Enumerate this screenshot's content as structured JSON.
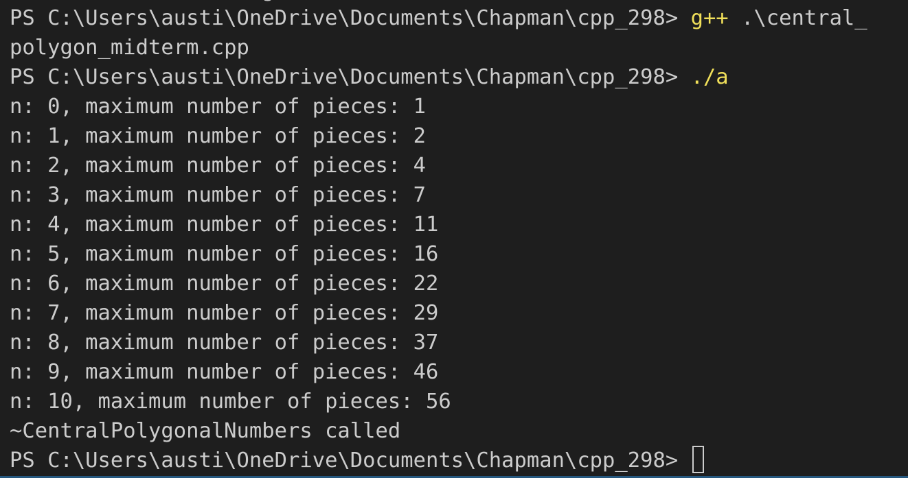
{
  "terminal": {
    "partial_top_line": "                    g",
    "prompt": "PS C:\\Users\\austi\\OneDrive\\Documents\\Chapman\\cpp_298> ",
    "command1_part1": "g++",
    "command1_part2": " .\\central_",
    "command1_wrap": "polygon_midterm.cpp",
    "command2": "./a",
    "output_lines": [
      "n: 0, maximum number of pieces: 1",
      "n: 1, maximum number of pieces: 2",
      "n: 2, maximum number of pieces: 4",
      "n: 3, maximum number of pieces: 7",
      "n: 4, maximum number of pieces: 11",
      "n: 5, maximum number of pieces: 16",
      "n: 6, maximum number of pieces: 22",
      "n: 7, maximum number of pieces: 29",
      "n: 8, maximum number of pieces: 37",
      "n: 9, maximum number of pieces: 46",
      "n: 10, maximum number of pieces: 56"
    ],
    "destructor_msg": "~CentralPolygonalNumbers called",
    "colors": {
      "background": "#1e1e1e",
      "text": "#cccccc",
      "command": "#f1e05a"
    }
  }
}
